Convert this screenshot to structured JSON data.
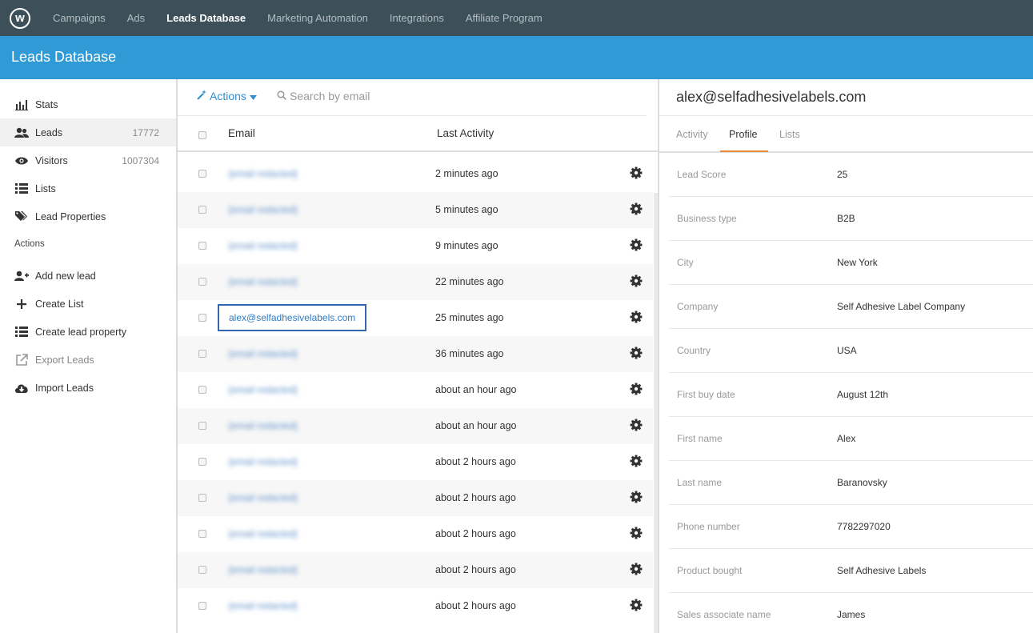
{
  "topnav": {
    "logo": "w",
    "links": [
      "Campaigns",
      "Ads",
      "Leads Database",
      "Marketing Automation",
      "Integrations",
      "Affiliate Program"
    ]
  },
  "header": {
    "title": "Leads Database"
  },
  "sidebar": {
    "items": [
      {
        "label": "Stats",
        "count": "",
        "icon": "bar-chart-icon"
      },
      {
        "label": "Leads",
        "count": "17772",
        "icon": "users-icon"
      },
      {
        "label": "Visitors",
        "count": "1007304",
        "icon": "eye-icon"
      },
      {
        "label": "Lists",
        "count": "",
        "icon": "list-icon"
      }
    ],
    "lead_properties": "Lead Properties",
    "actions_label": "Actions",
    "actions": [
      {
        "label": "Add new lead",
        "icon": "add-user-icon"
      },
      {
        "label": "Create List",
        "icon": "plus-icon"
      },
      {
        "label": "Create lead property",
        "icon": "list-icon"
      },
      {
        "label": "Export Leads",
        "icon": "export-icon"
      },
      {
        "label": "Import Leads",
        "icon": "cloud-download-icon"
      }
    ]
  },
  "list": {
    "actions_label": "Actions",
    "search_placeholder": "Search by email",
    "col_email": "Email",
    "col_activity": "Last Activity",
    "rows": [
      {
        "email": "[email redacted]",
        "time": "2 minutes ago"
      },
      {
        "email": "[email redacted]",
        "time": "5 minutes ago"
      },
      {
        "email": "[email redacted]",
        "time": "9 minutes ago"
      },
      {
        "email": "[email redacted]",
        "time": "22 minutes ago"
      },
      {
        "email": "alex@selfadhesivelabels.com",
        "time": "25 minutes ago",
        "selected": true
      },
      {
        "email": "[email redacted]",
        "time": "36 minutes ago"
      },
      {
        "email": "[email redacted]",
        "time": "about an hour ago"
      },
      {
        "email": "[email redacted]",
        "time": "about an hour ago"
      },
      {
        "email": "[email redacted]",
        "time": "about 2 hours ago"
      },
      {
        "email": "[email redacted]",
        "time": "about 2 hours ago"
      },
      {
        "email": "[email redacted]",
        "time": "about 2 hours ago"
      },
      {
        "email": "[email redacted]",
        "time": "about 2 hours ago"
      },
      {
        "email": "[email redacted]",
        "time": "about 2 hours ago"
      }
    ]
  },
  "detail": {
    "title": "alex@selfadhesivelabels.com",
    "tabs": [
      "Activity",
      "Profile",
      "Lists"
    ],
    "properties": [
      {
        "key": "Lead Score",
        "value": "25"
      },
      {
        "key": "Business type",
        "value": "B2B"
      },
      {
        "key": "City",
        "value": "New York"
      },
      {
        "key": "Company",
        "value": "Self Adhesive Label Company"
      },
      {
        "key": "Country",
        "value": "USA"
      },
      {
        "key": "First buy date",
        "value": "August 12th"
      },
      {
        "key": "First name",
        "value": "Alex"
      },
      {
        "key": "Last name",
        "value": "Baranovsky"
      },
      {
        "key": "Phone number",
        "value": "7782297020"
      },
      {
        "key": "Product bought",
        "value": "Self Adhesive Labels"
      },
      {
        "key": "Sales associate name",
        "value": "James"
      }
    ]
  },
  "colors": {
    "topnav": "#3d5059",
    "header": "#2f9ad6",
    "accent": "#2f8fd0",
    "tab_underline": "#e98a3a"
  }
}
